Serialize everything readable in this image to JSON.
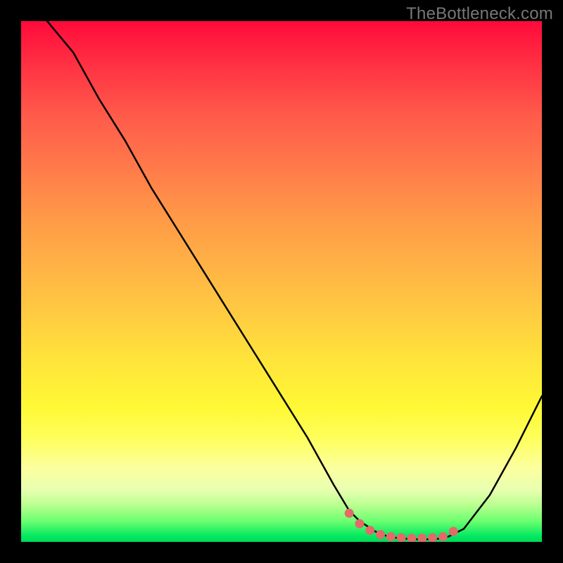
{
  "watermark": "TheBottleneck.com",
  "chart_data": {
    "type": "line",
    "title": "",
    "xlabel": "",
    "ylabel": "",
    "xlim": [
      0,
      100
    ],
    "ylim": [
      0,
      100
    ],
    "grid": false,
    "series": [
      {
        "name": "curve",
        "color": "#000000",
        "x": [
          5,
          10,
          15,
          20,
          25,
          30,
          35,
          40,
          45,
          50,
          55,
          60,
          63,
          65,
          68,
          70,
          72,
          75,
          78,
          80,
          82,
          85,
          90,
          95,
          100
        ],
        "y": [
          100,
          94,
          85,
          77,
          68,
          60,
          52,
          44,
          36,
          28,
          20,
          11,
          6,
          4,
          2,
          1.2,
          0.8,
          0.5,
          0.5,
          0.6,
          1.0,
          2.5,
          9,
          18,
          28
        ]
      },
      {
        "name": "dots",
        "color": "#e26a6a",
        "type": "scatter",
        "x": [
          63,
          65,
          67,
          69,
          71,
          73,
          75,
          77,
          79,
          81,
          83
        ],
        "y": [
          5.5,
          3.5,
          2.2,
          1.4,
          1.0,
          0.8,
          0.7,
          0.7,
          0.8,
          1.0,
          2.0
        ]
      }
    ],
    "gradient_stops": [
      {
        "pos": 0.0,
        "color": "#ff0a3a"
      },
      {
        "pos": 0.08,
        "color": "#ff2f43"
      },
      {
        "pos": 0.18,
        "color": "#ff5a4a"
      },
      {
        "pos": 0.28,
        "color": "#ff7a4a"
      },
      {
        "pos": 0.38,
        "color": "#ff9a47"
      },
      {
        "pos": 0.48,
        "color": "#ffb545"
      },
      {
        "pos": 0.58,
        "color": "#ffd040"
      },
      {
        "pos": 0.66,
        "color": "#ffe63a"
      },
      {
        "pos": 0.74,
        "color": "#fff835"
      },
      {
        "pos": 0.8,
        "color": "#feff5a"
      },
      {
        "pos": 0.86,
        "color": "#fbffa0"
      },
      {
        "pos": 0.9,
        "color": "#e8ffb0"
      },
      {
        "pos": 0.93,
        "color": "#b8ff90"
      },
      {
        "pos": 0.96,
        "color": "#6cff70"
      },
      {
        "pos": 0.99,
        "color": "#00e860"
      },
      {
        "pos": 1.0,
        "color": "#00d858"
      }
    ]
  }
}
